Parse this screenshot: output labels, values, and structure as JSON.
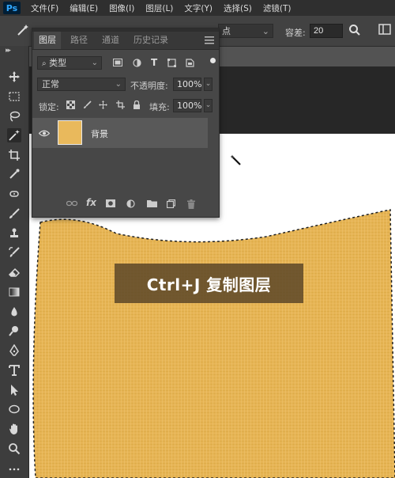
{
  "app": {
    "logo": "Ps"
  },
  "menu": [
    "文件(F)",
    "编辑(E)",
    "图像(I)",
    "图层(L)",
    "文字(Y)",
    "选择(S)",
    "滤镜(T)"
  ],
  "options": {
    "tool_icon": "magic-wand-icon",
    "sample_size": "点",
    "tolerance_label": "容差:",
    "tolerance_value": "20"
  },
  "layers_panel": {
    "tabs": [
      "图层",
      "路径",
      "通道",
      "历史记录"
    ],
    "filter_kind": "类型",
    "blend_mode": "正常",
    "opacity_label": "不透明度:",
    "opacity_value": "100%",
    "lock_label": "锁定:",
    "fill_label": "填充:",
    "fill_value": "100%",
    "layers": [
      {
        "name": "背景",
        "visible": true,
        "thumbnail_color": "#e9b95c"
      }
    ]
  },
  "canvas": {
    "caption": "Ctrl+J 复制图层",
    "object_color": "#e6b455"
  }
}
